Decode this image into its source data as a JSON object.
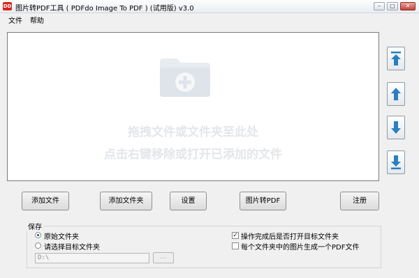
{
  "window": {
    "icon_text": "DD",
    "title": "图片转PDF工具 ( PDFdo Image To PDF ) (试用版) v3.0",
    "minimize_symbol": "–",
    "maximize_symbol": "□",
    "close_symbol": "✕"
  },
  "menu": {
    "file": "文件",
    "help": "帮助"
  },
  "drop_area": {
    "icon": "folder-add-icon",
    "hint_line1": "拖拽文件或文件夹至此处",
    "hint_line2": "点击右键移除或打开已添加的文件"
  },
  "side_buttons": [
    {
      "icon": "move-to-top-icon"
    },
    {
      "icon": "move-up-icon"
    },
    {
      "icon": "move-down-icon"
    },
    {
      "icon": "move-to-bottom-icon"
    }
  ],
  "buttons": {
    "add_file": "添加文件",
    "add_folder": "添加文件夹",
    "settings": "设置",
    "convert": "图片转PDF",
    "register": "注册"
  },
  "save": {
    "group_label": "保存",
    "option_original": "原始文件夹",
    "option_choose": "请选择目标文件夹",
    "selected": "original",
    "path": "D:\\",
    "browse_label": "...",
    "open_after": {
      "label": "操作完成后是否打开目标文件夹",
      "checked": true
    },
    "per_folder_pdf": {
      "label": "每个文件夹中的图片生成一个PDF文件",
      "checked": false
    }
  },
  "colors": {
    "accent_blue": "#2a7fc0",
    "app_icon_red": "#d7261e"
  }
}
